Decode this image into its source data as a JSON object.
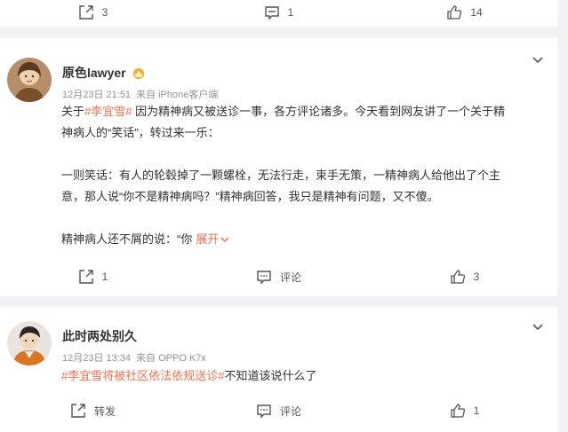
{
  "top_actions": {
    "repost_count": "3",
    "comment_count": "1",
    "like_count": "14"
  },
  "posts": [
    {
      "author": "原色lawyer",
      "time": "12月23日 21:51",
      "source": "来自 iPhone客户端",
      "paragraphs": {
        "p1": {
          "pre": "关于",
          "tag": "#李宜雪#",
          "line1_rest": " 因为精神病又被送诊一事，各方评论诸多。今天看到网友讲了一个关于精",
          "line2": "神病人的“笑话”，转过来一乐："
        },
        "p2": {
          "line1": "一则笑话：有人的轮毂掉了一颗螺栓，无法行走，束手无策，一精神病人给他出了个主",
          "line2": "意，那人说“你不是精神病吗？”精神病回答，我只是精神有问题，又不傻。"
        },
        "p3": {
          "text": "精神病人还不屑的说：“你",
          "expand": "展开"
        }
      },
      "actions": {
        "repost": "1",
        "comment": "评论",
        "like": "3"
      }
    },
    {
      "author": "此时两处别久",
      "time": "12月23日 13:34",
      "source": "来自 OPPO K7x",
      "tag": "#李宜雪将被社区依法依规送诊#",
      "text": "不知道该说什么了",
      "actions": {
        "repost": "转发",
        "comment": "评论",
        "like": "1"
      }
    }
  ],
  "colors": {
    "accent": "#eb7350",
    "muted": "#939393",
    "crown": "#f5a623"
  }
}
